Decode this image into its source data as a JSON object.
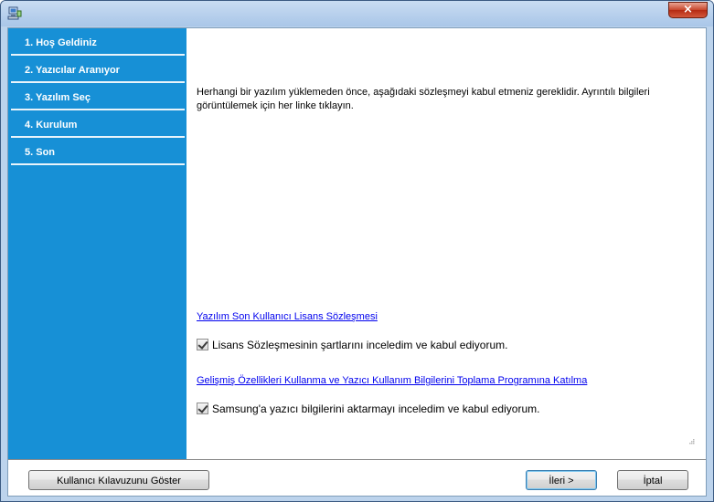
{
  "window": {
    "close_glyph": "×",
    "accent": "#1790d6",
    "close_color": "#c7452c"
  },
  "sidebar": {
    "steps": [
      {
        "label": "1. Hoş Geldiniz"
      },
      {
        "label": "2. Yazıcılar Aranıyor"
      },
      {
        "label": "3. Yazılım Seç"
      },
      {
        "label": "4. Kurulum"
      },
      {
        "label": "5. Son"
      }
    ]
  },
  "content": {
    "intro": "Herhangi bir yazılım yüklemeden önce, aşağıdaki sözleşmeyi kabul etmeniz gereklidir. Ayrıntılı bilgileri görüntülemek için her linke tıklayın.",
    "license_link": "Yazılım Son Kullanıcı Lisans Sözleşmesi",
    "license_checkbox": {
      "label": "Lisans Sözleşmesinin şartlarını inceledim ve kabul ediyorum.",
      "checked": true
    },
    "program_link": "Gelişmiş Özellikleri Kullanma ve Yazıcı Kullanım Bilgilerini Toplama Programına Katılma",
    "program_checkbox": {
      "label": "Samsung'a yazıcı bilgilerini aktarmayı inceledim ve kabul ediyorum.",
      "checked": true
    }
  },
  "footer": {
    "guide_button": "Kullanıcı Kılavuzunu Göster",
    "next_button": "İleri >",
    "cancel_button": "İptal"
  },
  "icons": {
    "app": "computer-installer-icon",
    "close": "close-icon",
    "check": "checkmark-icon",
    "grip": "resize-grip-icon"
  }
}
